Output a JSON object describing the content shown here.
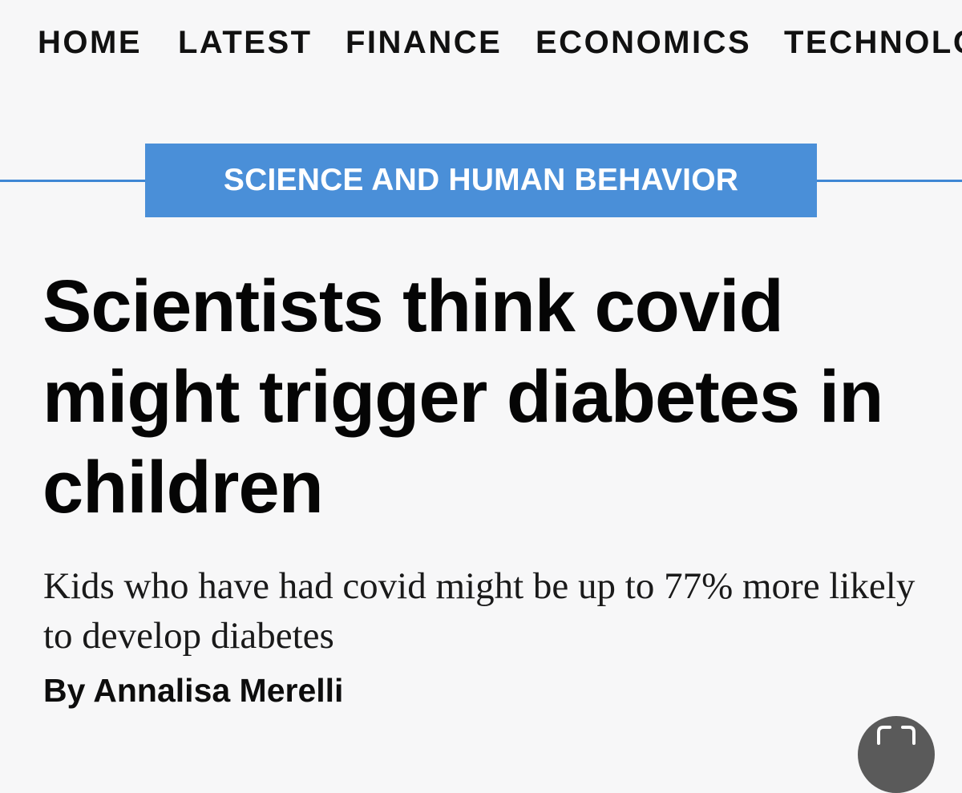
{
  "nav": {
    "items": [
      {
        "label": "HOME"
      },
      {
        "label": "LATEST"
      },
      {
        "label": "FINANCE"
      },
      {
        "label": "ECONOMICS"
      },
      {
        "label": "TECHNOLOGY"
      }
    ]
  },
  "article": {
    "section": "SCIENCE AND HUMAN BEHAVIOR",
    "headline": "Scientists think covid might trigger diabetes in children",
    "dek": "Kids who have had covid might be up to 77% more likely to develop diabetes",
    "byline": "By Annalisa Merelli"
  },
  "icons": {
    "expand": "expand-icon"
  },
  "colors": {
    "section_accent": "#4a8fd8",
    "background": "#f7f7f8"
  }
}
